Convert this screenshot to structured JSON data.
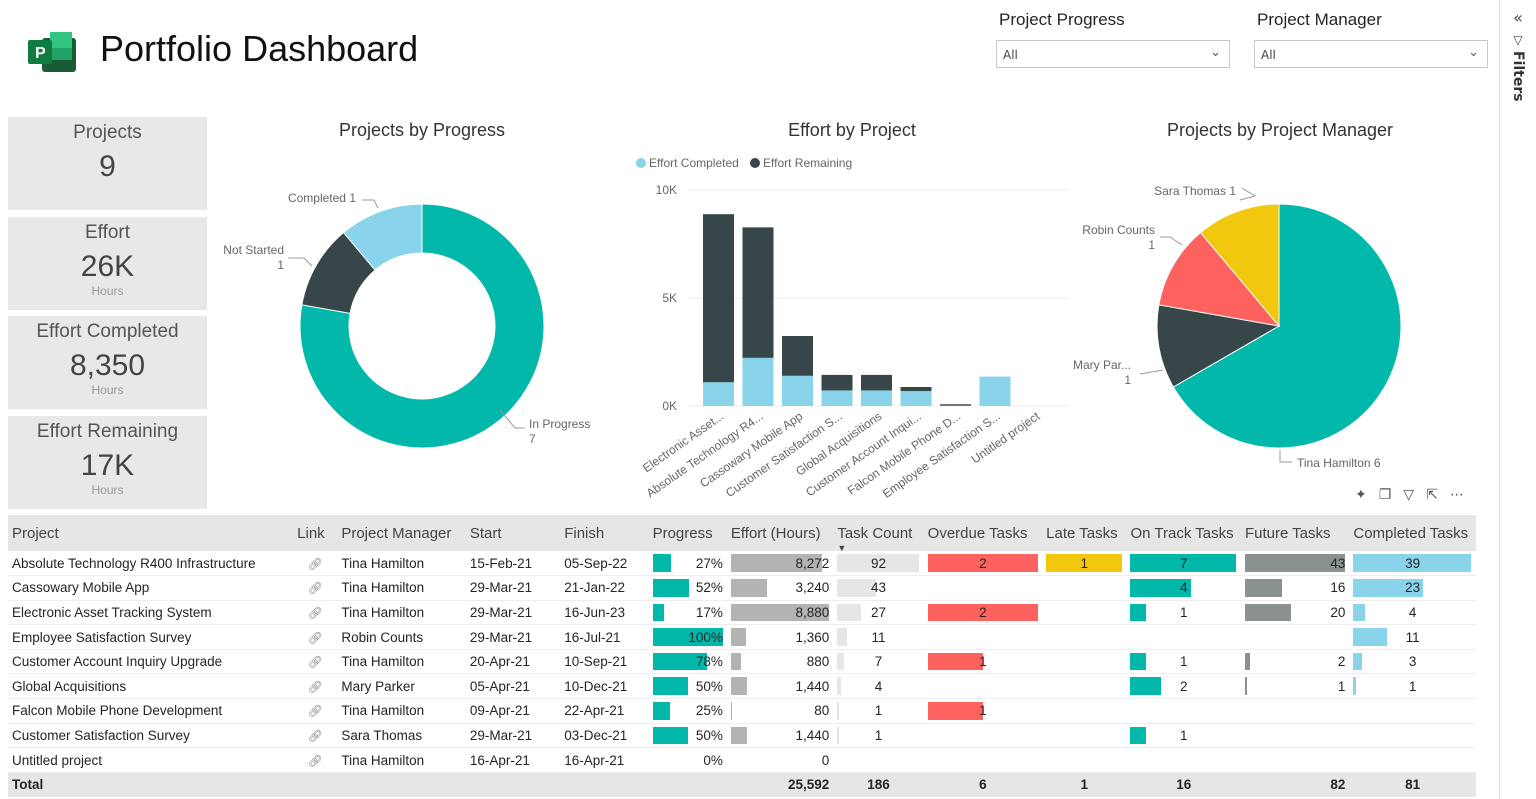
{
  "header": {
    "title": "Portfolio Dashboard",
    "logo_letter": "P"
  },
  "slicers": [
    {
      "label": "Project Progress",
      "value": "All"
    },
    {
      "label": "Project Manager",
      "value": "All"
    }
  ],
  "filters_pane": {
    "label": "Filters"
  },
  "cards": [
    {
      "label": "Projects",
      "value": "9",
      "sub": ""
    },
    {
      "label": "Effort",
      "value": "26K",
      "sub": "Hours"
    },
    {
      "label": "Effort Completed",
      "value": "8,350",
      "sub": "Hours"
    },
    {
      "label": "Effort Remaining",
      "value": "17K",
      "sub": "Hours"
    }
  ],
  "colors": {
    "teal": "#01b8aa",
    "dark": "#374649",
    "red": "#fd625e",
    "yellow": "#f2c80f",
    "light_blue": "#8ad4eb",
    "gray": "#b3b3b3",
    "future_gray": "#8b9091"
  },
  "chart_data": [
    {
      "type": "pie",
      "title": "Projects by Progress",
      "donut": true,
      "slices": [
        {
          "label": "In Progress",
          "value": 7
        },
        {
          "label": "Not Started",
          "value": 1
        },
        {
          "label": "Completed",
          "value": 1
        }
      ]
    },
    {
      "type": "bar",
      "stacked": true,
      "title": "Effort by Project",
      "legend": "top-left",
      "ylim": [
        0,
        10000
      ],
      "yticks": [
        "0K",
        "5K",
        "10K"
      ],
      "categories": [
        "Electronic Asset...",
        "Absolute Technology R4...",
        "Cassowary Mobile App",
        "Customer Satisfaction S...",
        "Global Acquisitions",
        "Customer Account Inqui...",
        "Falcon Mobile Phone D...",
        "Employee Satisfaction S...",
        "Untitled project"
      ],
      "series": [
        {
          "name": "Effort Completed",
          "values": [
            1100,
            2230,
            1400,
            720,
            720,
            690,
            20,
            1360,
            0
          ]
        },
        {
          "name": "Effort Remaining",
          "values": [
            7780,
            6040,
            1840,
            720,
            720,
            190,
            60,
            0,
            0
          ]
        }
      ]
    },
    {
      "type": "pie",
      "title": "Projects by Project Manager",
      "slices": [
        {
          "label": "Tina Hamilton",
          "value": 6
        },
        {
          "label": "Mary Par...",
          "value": 1
        },
        {
          "label": "Robin Counts",
          "value": 1
        },
        {
          "label": "Sara Thomas",
          "value": 1
        }
      ]
    }
  ],
  "table": {
    "columns": [
      "Project",
      "Link",
      "Project Manager",
      "Start",
      "Finish",
      "Progress",
      "Effort (Hours)",
      "Task Count",
      "Overdue Tasks",
      "Late Tasks",
      "On Track Tasks",
      "Future Tasks",
      "Completed Tasks"
    ],
    "rows": [
      [
        "Absolute Technology R400 Infrastructure",
        "Tina Hamilton",
        "15-Feb-21",
        "05-Sep-22",
        "27%",
        "8,272",
        "92",
        "2",
        "1",
        "7",
        "43",
        "39"
      ],
      [
        "Cassowary Mobile App",
        "Tina Hamilton",
        "29-Mar-21",
        "21-Jan-22",
        "52%",
        "3,240",
        "43",
        "",
        "",
        "4",
        "16",
        "23"
      ],
      [
        "Electronic Asset Tracking System",
        "Tina Hamilton",
        "29-Mar-21",
        "16-Jun-23",
        "17%",
        "8,880",
        "27",
        "2",
        "",
        "1",
        "20",
        "4"
      ],
      [
        "Employee Satisfaction Survey",
        "Robin Counts",
        "29-Mar-21",
        "16-Jul-21",
        "100%",
        "1,360",
        "11",
        "",
        "",
        "",
        "",
        "11"
      ],
      [
        "Customer Account Inquiry Upgrade",
        "Tina Hamilton",
        "20-Apr-21",
        "10-Sep-21",
        "78%",
        "880",
        "7",
        "1",
        "",
        "1",
        "2",
        "3"
      ],
      [
        "Global Acquisitions",
        "Mary Parker",
        "05-Apr-21",
        "10-Dec-21",
        "50%",
        "1,440",
        "4",
        "",
        "",
        "2",
        "1",
        "1"
      ],
      [
        "Falcon Mobile Phone Development",
        "Tina Hamilton",
        "09-Apr-21",
        "22-Apr-21",
        "25%",
        "80",
        "1",
        "1",
        "",
        "",
        "",
        ""
      ],
      [
        "Customer Satisfaction Survey",
        "Sara Thomas",
        "29-Mar-21",
        "03-Dec-21",
        "50%",
        "1,440",
        "1",
        "",
        "",
        "1",
        "",
        ""
      ],
      [
        "Untitled project",
        "Tina Hamilton",
        "16-Apr-21",
        "16-Apr-21",
        "0%",
        "0",
        "",
        "",
        "",
        "",
        "",
        ""
      ]
    ],
    "total": {
      "label": "Total",
      "effort": "25,592",
      "tasks": "186",
      "overdue": "6",
      "late": "1",
      "ontrack": "16",
      "future": "82",
      "completed": "81"
    }
  }
}
